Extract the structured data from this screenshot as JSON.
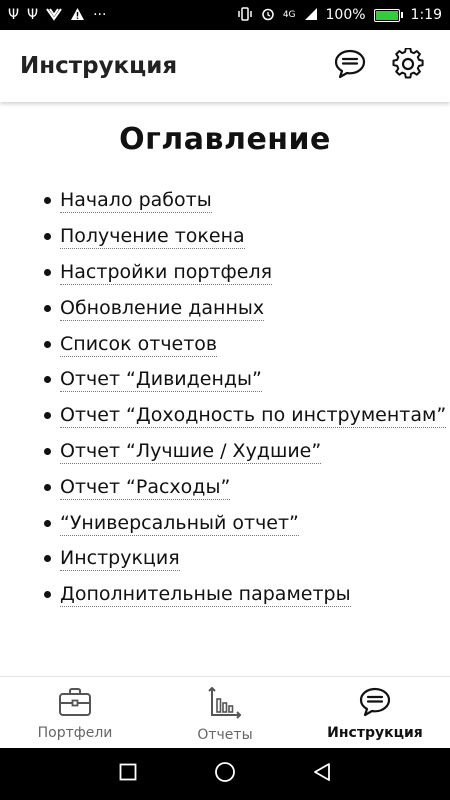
{
  "status_bar": {
    "left_icons": [
      "usb-icon",
      "usb-icon",
      "vpn-icon",
      "warning-icon",
      "more-icon"
    ],
    "network_label": "4G",
    "battery_percent": "100%",
    "battery_level": 1.0,
    "time": "1:19"
  },
  "app_bar": {
    "title": "Инструкция",
    "actions": [
      "chat-icon",
      "gear-icon"
    ]
  },
  "toc": {
    "title": "Оглавление",
    "items": [
      "Начало работы",
      "Получение токена",
      "Настройки портфеля",
      "Обновление данных",
      "Список отчетов",
      "Отчет “Дивиденды”",
      "Отчет “Доходность по инструментам”",
      "Отчет “Лучшие / Худшие”",
      "Отчет “Расходы”",
      "“Универсальный отчет”",
      "Инструкция",
      "Дополнительные параметры"
    ]
  },
  "bottom_nav": {
    "items": [
      {
        "label": "Портфели",
        "icon": "briefcase-icon",
        "active": false
      },
      {
        "label": "Отчеты",
        "icon": "chart-icon",
        "active": false
      },
      {
        "label": "Инструкция",
        "icon": "chat-icon",
        "active": true
      }
    ]
  },
  "system_nav": [
    "recents-icon",
    "home-icon",
    "back-icon"
  ]
}
